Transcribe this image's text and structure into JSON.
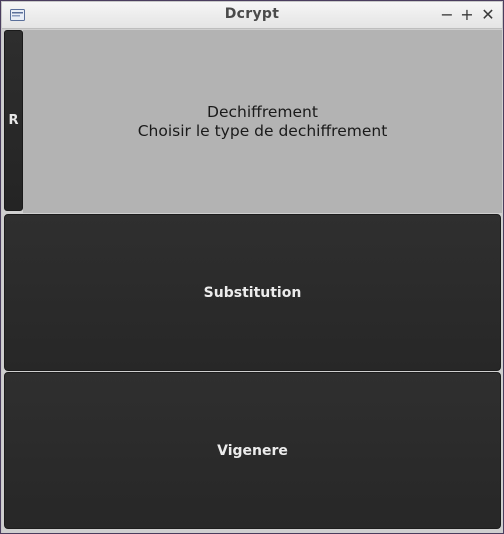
{
  "window": {
    "title": "Dcrypt",
    "controls": {
      "minimize": "−",
      "maximize": "+",
      "close": "✕"
    }
  },
  "side_button": {
    "label": "R"
  },
  "header": {
    "heading": "Dechiffrement",
    "subheading": "Choisir le type de dechiffrement"
  },
  "options": {
    "substitution": "Substitution",
    "vigenere": "Vigenere"
  },
  "colors": {
    "button_background": "#2b2b2b",
    "header_background": "#b3b3b3",
    "button_text": "#ececec"
  }
}
